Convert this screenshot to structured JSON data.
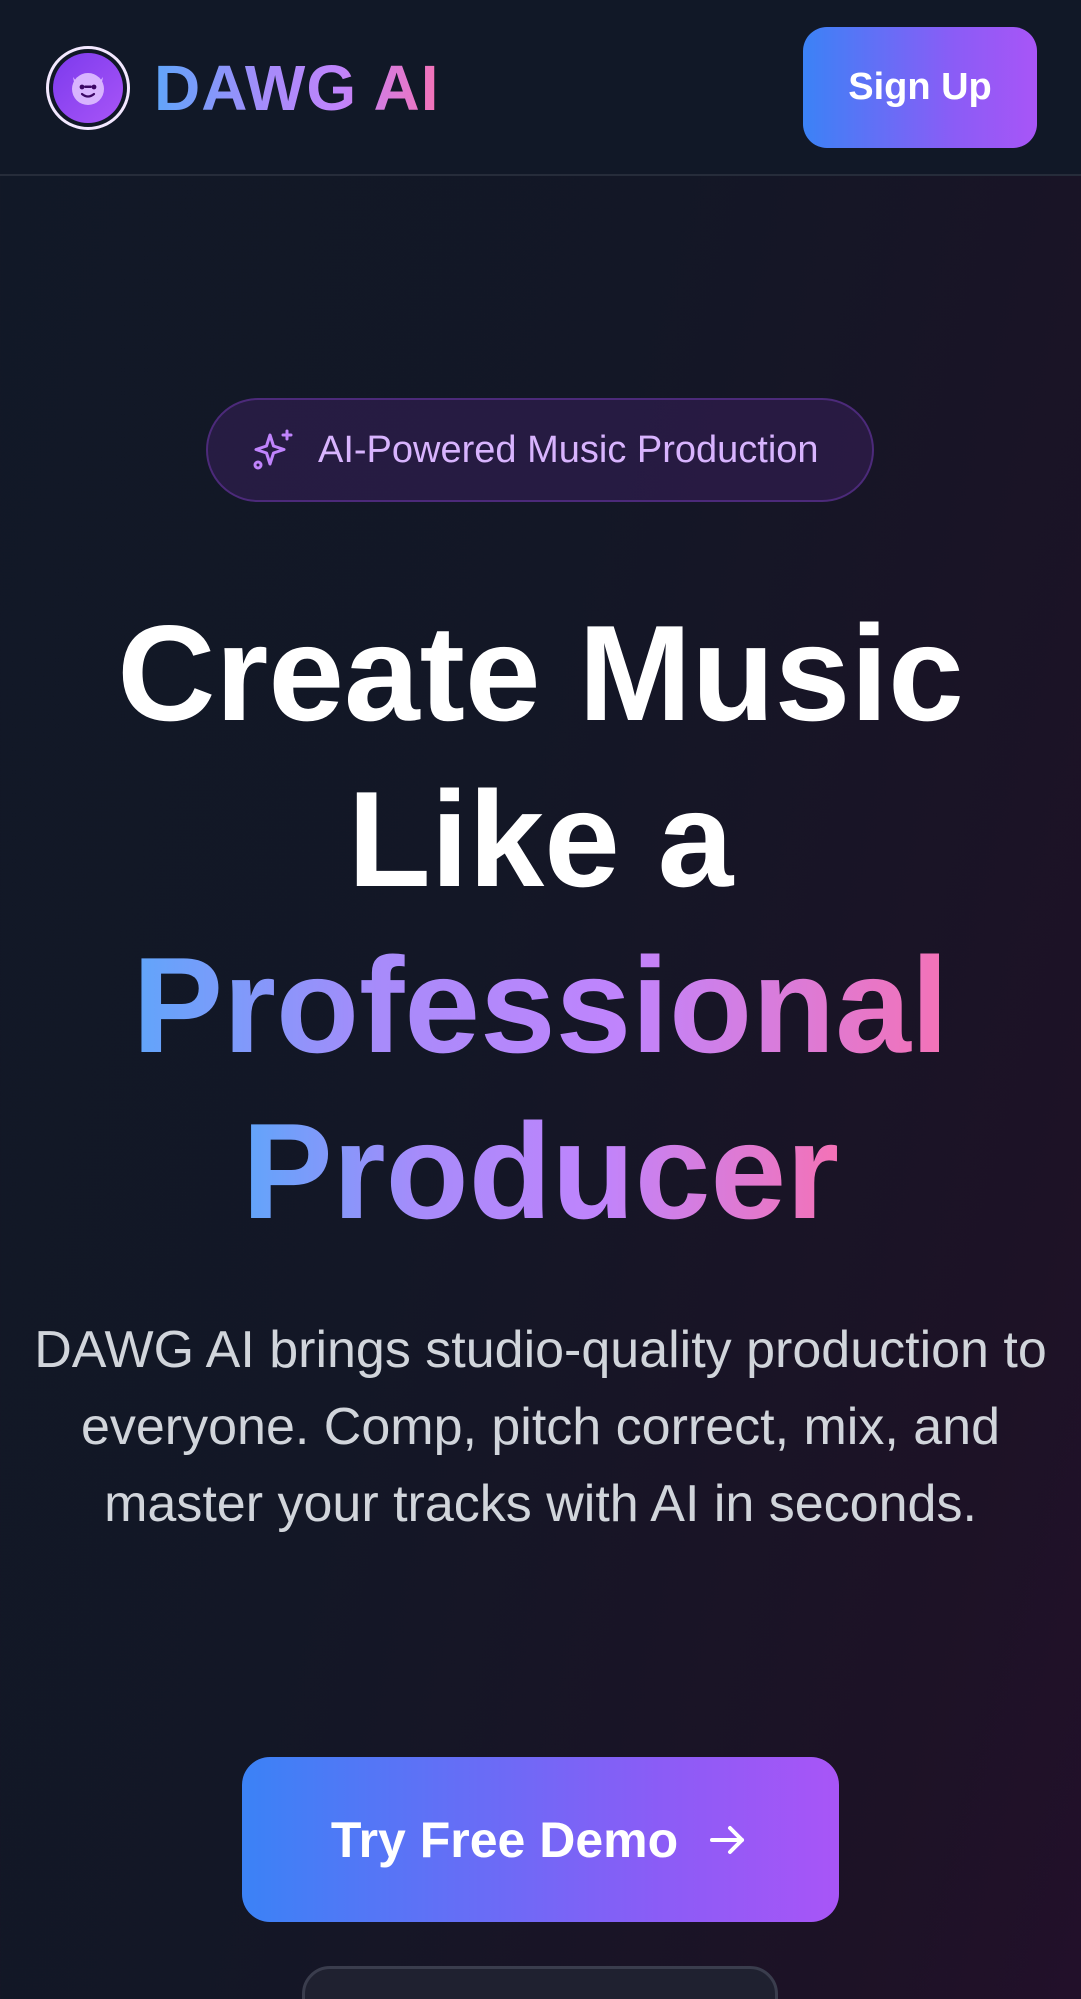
{
  "header": {
    "brand": "DAWG AI",
    "logo_icon": "dog-face-icon",
    "signup_label": "Sign Up"
  },
  "hero": {
    "badge_icon": "sparkles-icon",
    "badge_text": "AI-Powered Music Production",
    "headline_line1": "Create Music",
    "headline_line2": "Like a",
    "headline_line3": "Professional",
    "headline_line4": "Producer",
    "subtext": "DAWG AI brings studio-quality production to everyone. Comp, pitch correct, mix, and master your tracks with AI in seconds.",
    "cta_label": "Try Free Demo",
    "cta_icon": "arrow-right-icon"
  },
  "colors": {
    "background": "#111827",
    "accent_blue": "#3b82f6",
    "accent_purple": "#a855f7",
    "accent_pink": "#f472b6",
    "badge_text": "#d8b4fe"
  }
}
